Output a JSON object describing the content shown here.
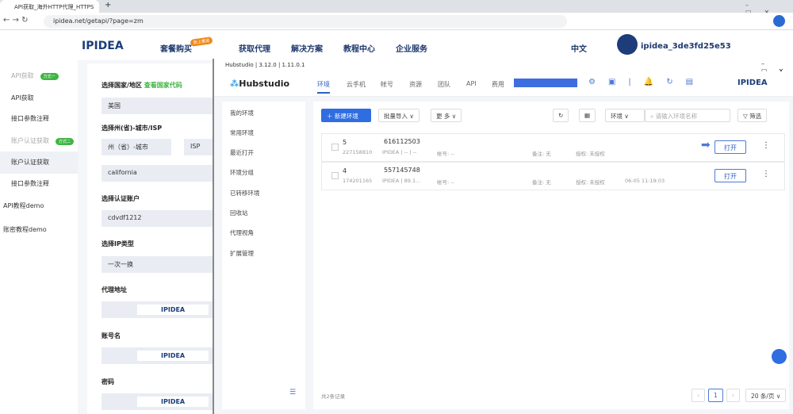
{
  "browser": {
    "tab_title": "API获取_海外HTTP代理_HTTPS",
    "url": "ipidea.net/getapi/?page=zm"
  },
  "site": {
    "logo": "IPIDEA",
    "nav": [
      "套餐购买",
      "获取代理",
      "解决方案",
      "教程中心",
      "企业服务"
    ],
    "promo_badge": "新上惠减",
    "language": "中文",
    "username": "ipidea_3de3fd25e53"
  },
  "left_menu": [
    {
      "label": "API获取",
      "badge": "方式一"
    },
    {
      "label": "API获取"
    },
    {
      "label": "接口参数注释"
    },
    {
      "label": "账户认证获取",
      "badge": "方式二"
    },
    {
      "label": "账户认证获取"
    },
    {
      "label": "接口参数注释"
    },
    {
      "label": "API教程demo"
    },
    {
      "label": "账密教程demo"
    }
  ],
  "form": {
    "country_label": "选择国家/地区",
    "country_link": "查看国家代码",
    "country": "美国",
    "state_label": "选择州(省)-城市/ISP",
    "state_placeholder": "州（省）-城市",
    "isp": "ISP",
    "state_value": "california",
    "account_label": "选择认证账户",
    "account": "cdvdf1212",
    "ip_type_label": "选择IP类型",
    "ip_type": "一次一换",
    "proxy_label": "代理地址",
    "user_label": "账号名",
    "pwd_label": "密码",
    "masked": "IPIDEA"
  },
  "hub": {
    "title": "Hubstudio | 3.12.0 | 1.11.0.1",
    "logo": "Hubstudio",
    "nav": [
      "环境",
      "云手机",
      "帐号",
      "资源",
      "团队",
      "API",
      "费用"
    ],
    "brand": "IPIDEA",
    "side": [
      "我的环境",
      "常用环境",
      "最近打开",
      "环境分组",
      "已转移环境",
      "回收站",
      "代理视角",
      "扩展管理"
    ],
    "toolbar": {
      "new": "新建环境",
      "import": "批量导入",
      "more": "更 多",
      "env": "环境",
      "search_placeholder": "请输入环境名称",
      "filter": "筛选"
    },
    "rows": [
      {
        "num": "5",
        "id": "227158810",
        "name": "616112503",
        "proxy": "IPIDEA",
        "ip": "-- | --",
        "account": "帐号: --",
        "note": "备注: 无",
        "auth": "授权: 未授权",
        "time": "",
        "open": "打开"
      },
      {
        "num": "4",
        "id": "174201165",
        "name": "557145748",
        "proxy": "IPIDEA",
        "ip": "89.1...",
        "account": "帐号: --",
        "note": "备注: 无",
        "auth": "授权: 未授权",
        "time": "06-05 11:19:03",
        "open": "打开"
      }
    ],
    "total": "共2条记录",
    "page": "1",
    "page_size": "20 条/页"
  }
}
